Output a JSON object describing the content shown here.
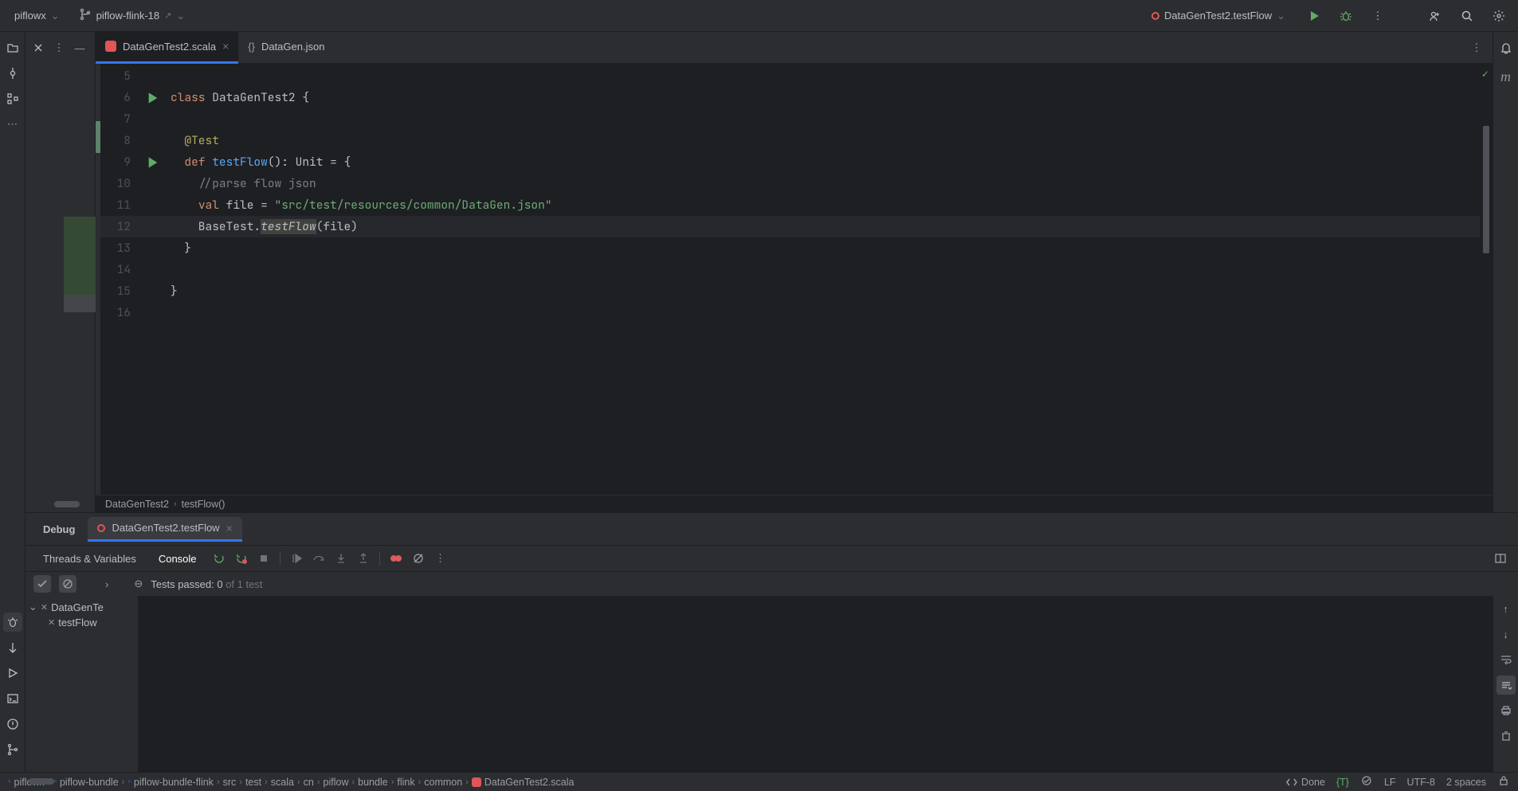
{
  "titlebar": {
    "project": "piflowx",
    "branch": "piflow-flink-18",
    "run_config": "DataGenTest2.testFlow"
  },
  "tabs": [
    {
      "label": "DataGenTest2.scala",
      "active": true
    },
    {
      "label": "DataGen.json",
      "active": false
    }
  ],
  "code": {
    "lines": [
      {
        "n": 5,
        "html": ""
      },
      {
        "n": 6,
        "run": true,
        "html": "<span class='kw'>class</span> DataGenTest2 {"
      },
      {
        "n": 7,
        "html": ""
      },
      {
        "n": 8,
        "html": "  <span class='anno'>@Test</span>"
      },
      {
        "n": 9,
        "run": true,
        "html": "  <span class='kw'>def</span> <span class='fn'>testFlow</span>(): Unit = {"
      },
      {
        "n": 10,
        "html": "    <span class='comment'>//parse flow json</span>"
      },
      {
        "n": 11,
        "html": "    <span class='kw'>val</span> file = <span class='str'>\"src/test/resources/common/DataGen.json\"</span>"
      },
      {
        "n": 12,
        "current": true,
        "html": "    BaseTest.<span class='ital'><span class='ident-hl'>testFlow</span></span>(file)"
      },
      {
        "n": 13,
        "html": "  }"
      },
      {
        "n": 14,
        "html": ""
      },
      {
        "n": 15,
        "html": "}"
      },
      {
        "n": 16,
        "html": ""
      }
    ]
  },
  "breadcrumb_inner": [
    "DataGenTest2",
    "testFlow()"
  ],
  "debug": {
    "title": "Debug",
    "run_tab": "DataGenTest2.testFlow",
    "toolbar_tabs": [
      "Threads & Variables",
      "Console"
    ],
    "tests_passed_prefix": "Tests passed: ",
    "tests_passed_count": "0",
    "tests_passed_suffix": " of 1 test",
    "tree": [
      {
        "label": "DataGenTe",
        "depth": 0,
        "expand": true
      },
      {
        "label": "testFlow",
        "depth": 1,
        "expand": false
      }
    ]
  },
  "status": {
    "path": [
      "piflowx",
      "piflow-bundle",
      "piflow-bundle-flink",
      "src",
      "test",
      "scala",
      "cn",
      "piflow",
      "bundle",
      "flink",
      "common",
      "DataGenTest2.scala"
    ],
    "done": "Done",
    "t": "T",
    "lf": "LF",
    "encoding": "UTF-8",
    "indent": "2 spaces"
  }
}
